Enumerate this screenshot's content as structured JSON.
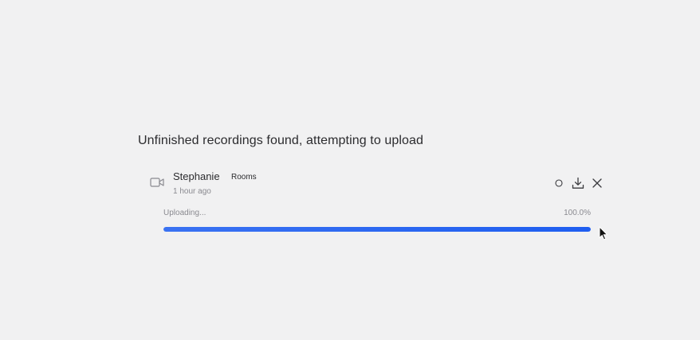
{
  "dialog": {
    "heading": "Unfinished recordings found, attempting to upload"
  },
  "recording": {
    "name": "Stephanie",
    "tag": "Rooms",
    "time": "1 hour ago",
    "status": "Uploading...",
    "percent_label": "100.0%",
    "progress": 1.0
  },
  "icons": {
    "type": "video-camera-icon",
    "status": "circle-icon",
    "download": "download-icon",
    "close": "close-icon"
  },
  "colors": {
    "progress_fill": "#1f5ef0",
    "background": "#f1f1f2"
  }
}
